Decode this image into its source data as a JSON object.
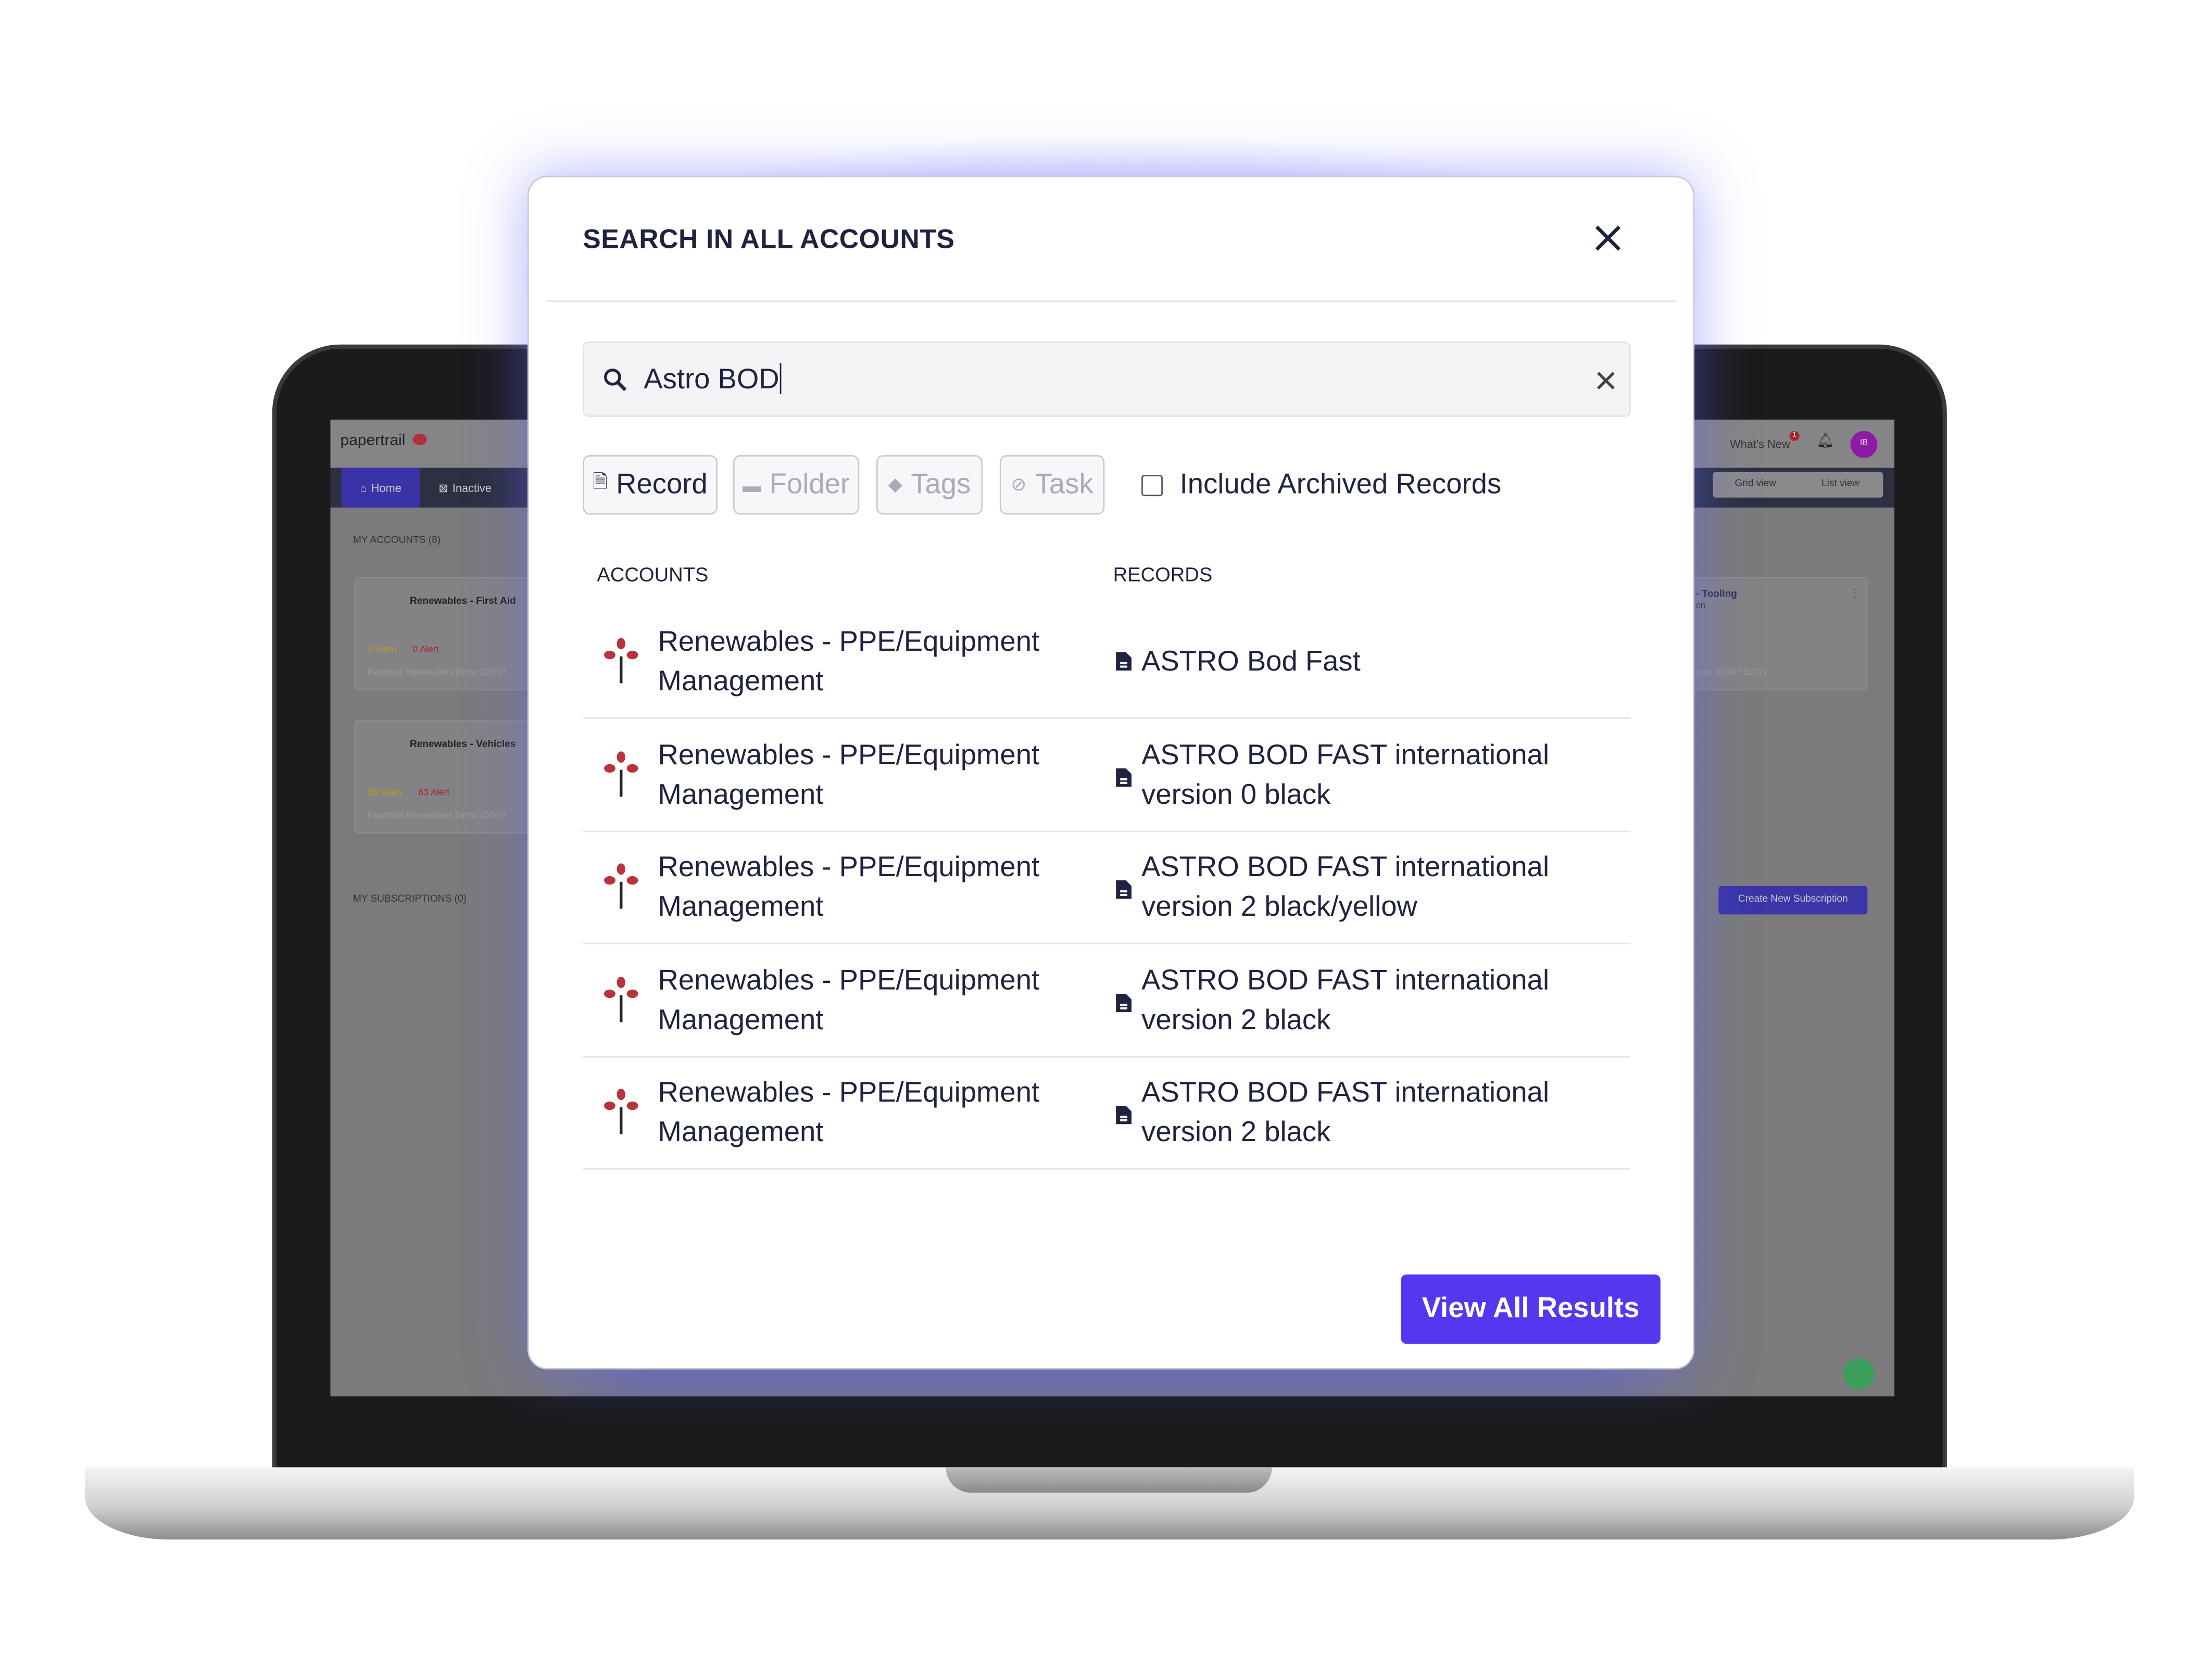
{
  "background_app": {
    "logo": "papertrail",
    "nav_tabs": [
      {
        "label": "Home",
        "icon": "home-icon"
      },
      {
        "label": "Inactive",
        "icon": "inactive-icon"
      }
    ],
    "whats_new": "What's New",
    "whats_new_badge": "1",
    "avatar_initials": "IB",
    "view_toggle": [
      "Grid view",
      "List view"
    ],
    "my_accounts_heading": "MY ACCOUNTS (8)",
    "account_cards": [
      {
        "name": "Renewables - First Aid",
        "warn": "2 Warn",
        "alert": "0 Alert",
        "org": "Papertrail Renewables Demo (DONT"
      },
      {
        "name": "Renewables - Vehicles",
        "warn": "38 Warn",
        "alert": "63 Alert",
        "org": "Papertrail Renewables Demo (DONT"
      },
      {
        "name": "- Tooling",
        "sub": "on",
        "org": "emo (DONT EDIT)"
      }
    ],
    "my_subscriptions_heading": "MY SUBSCRIPTIONS (0)",
    "create_subscription": "Create New Subscription"
  },
  "modal": {
    "title": "SEARCH IN ALL ACCOUNTS",
    "search_value": "Astro BOD",
    "filters": [
      {
        "label": "Record",
        "icon": "record-icon",
        "active": true
      },
      {
        "label": "Folder",
        "icon": "folder-icon",
        "active": false
      },
      {
        "label": "Tags",
        "icon": "tag-icon",
        "active": false
      },
      {
        "label": "Task",
        "icon": "task-icon",
        "active": false
      }
    ],
    "include_archived_label": "Include Archived Records",
    "include_archived_checked": false,
    "columns": {
      "accounts": "ACCOUNTS",
      "records": "RECORDS"
    },
    "results": [
      {
        "account": "Renewables - PPE/Equipment Management",
        "record": "ASTRO Bod Fast"
      },
      {
        "account": "Renewables - PPE/Equipment Management",
        "record": "ASTRO BOD FAST international version 0 black"
      },
      {
        "account": "Renewables - PPE/Equipment Management",
        "record": "ASTRO BOD FAST international version 2 black/yellow"
      },
      {
        "account": "Renewables - PPE/Equipment Management",
        "record": "ASTRO BOD FAST international version 2 black"
      },
      {
        "account": "Renewables - PPE/Equipment Management",
        "record": "ASTRO BOD FAST international version 2 black"
      }
    ],
    "view_all_label": "View All Results"
  },
  "colors": {
    "primary": "#5438f0",
    "text": "#1f2340",
    "warn": "#c9a227",
    "alert": "#c0392b",
    "avatar": "#8e1aa6"
  }
}
